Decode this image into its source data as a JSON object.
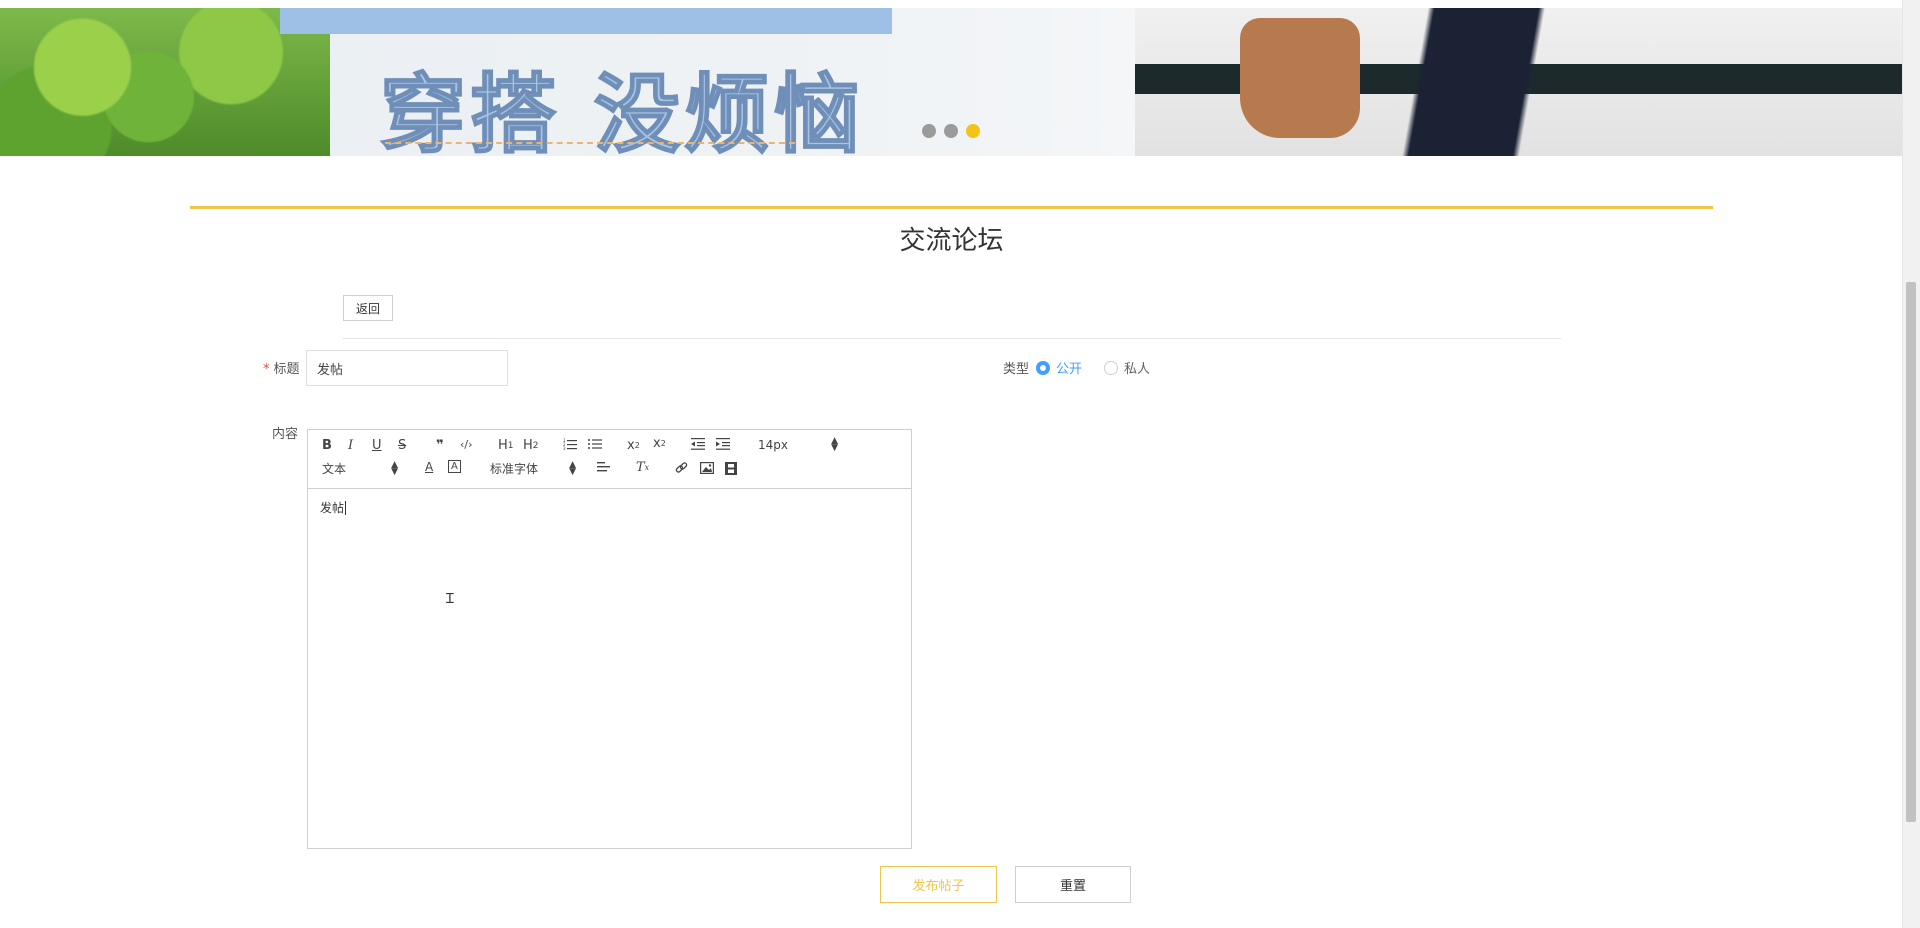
{
  "banner": {
    "slogan": "穿搭 没烦恼",
    "dots": [
      false,
      false,
      true
    ]
  },
  "section": {
    "title": "交流论坛",
    "back_label": "返回"
  },
  "form": {
    "title_label": "标题",
    "title_value": "发帖",
    "type_label": "类型",
    "type_options": [
      {
        "label": "公开",
        "checked": true
      },
      {
        "label": "私人",
        "checked": false
      }
    ],
    "content_label": "内容"
  },
  "editor": {
    "font_size": "14px",
    "header_select": "文本",
    "font_family": "标准字体",
    "content": "发帖",
    "toolbar_icons": [
      "B",
      "I",
      "U",
      "S",
      "quote-icon",
      "code-icon",
      "H1",
      "H2",
      "ordered-list-icon",
      "bullet-list-icon",
      "subscript-icon",
      "superscript-icon",
      "outdent-icon",
      "indent-icon",
      "font-color-icon",
      "background-color-icon",
      "align-icon",
      "clean-icon",
      "link-icon",
      "image-icon",
      "video-icon"
    ]
  },
  "actions": {
    "publish_label": "发布帖子",
    "reset_label": "重置"
  },
  "colors": {
    "accent": "#f1c44a",
    "primary": "#409eff"
  }
}
